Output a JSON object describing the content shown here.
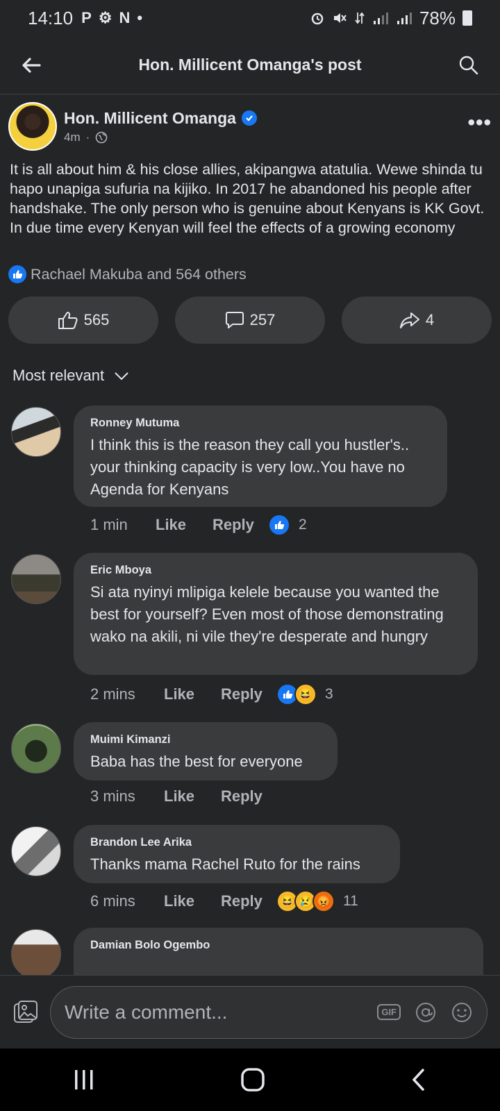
{
  "status_bar": {
    "time": "14:10",
    "left_icons": [
      "P",
      "⚙",
      "N",
      "•"
    ],
    "battery": "78%"
  },
  "header": {
    "title": "Hon. Millicent Omanga's post"
  },
  "post": {
    "author": "Hon. Millicent Omanga",
    "time": "4m",
    "separator": "·",
    "text": "It is all about him & his close allies, akipangwa atatulia. Wewe shinda tu hapo unapiga sufuria na kijiko. In 2017 he abandoned his people after handshake. The only person who is genuine about Kenyans is KK Govt. In due time every Kenyan will feel the effects of a growing economy",
    "reactions_summary": "Rachael Makuba and 564 others",
    "likes": "565",
    "comments": "257",
    "shares": "4"
  },
  "sort": {
    "label": "Most relevant"
  },
  "comments": [
    {
      "name": "Ronney Mutuma",
      "text": "I think this is the reason they call you hustler's.. your thinking capacity is very low..You have no Agenda for Kenyans",
      "time": "1 min",
      "like": "Like",
      "reply": "Reply",
      "reaction_count": "2"
    },
    {
      "name": "Eric Mboya",
      "text": "Si ata nyinyi mlipiga kelele because you wanted the best for yourself? Even most of those demonstrating wako na akili, ni vile they're desperate and hungry",
      "time": "2 mins",
      "like": "Like",
      "reply": "Reply",
      "reaction_count": "3"
    },
    {
      "name": "Muimi Kimanzi",
      "text": "Baba has the best for everyone",
      "time": "3 mins",
      "like": "Like",
      "reply": "Reply"
    },
    {
      "name": "Brandon Lee Arika",
      "text": "Thanks mama Rachel Ruto for the rains",
      "time": "6 mins",
      "like": "Like",
      "reply": "Reply",
      "reaction_count": "11"
    },
    {
      "name": "Damian Bolo Ogembo"
    }
  ],
  "composer": {
    "placeholder": "Write a comment...",
    "gif": "GIF"
  },
  "colors": {
    "background": "#242526",
    "bubble": "#3a3b3c",
    "accent": "#1877f2",
    "text": "#e4e6eb",
    "muted": "#b0b3b8"
  }
}
